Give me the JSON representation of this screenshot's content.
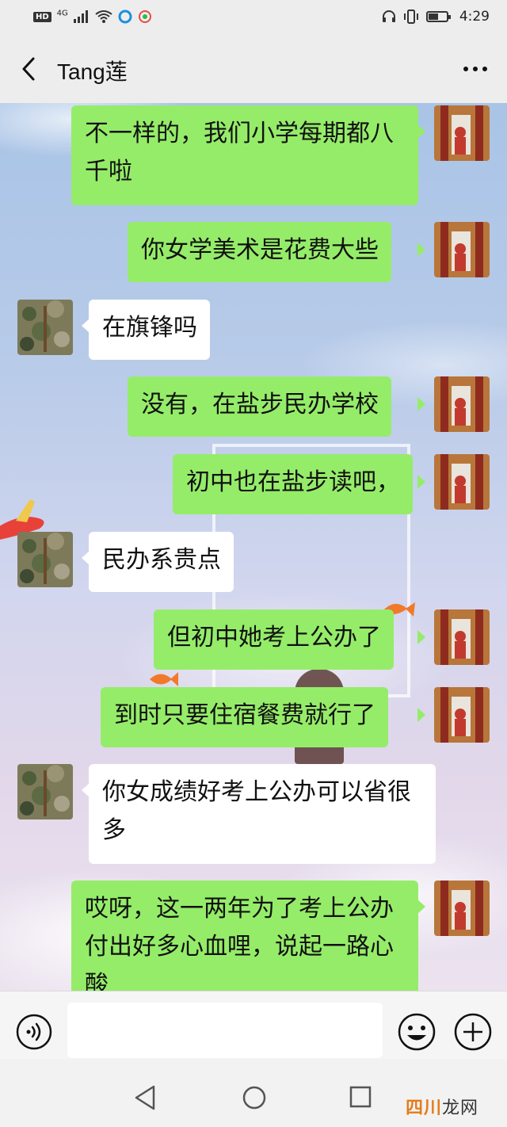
{
  "status_bar": {
    "network_badge": "HD",
    "network_type": "4G",
    "time": "4:29"
  },
  "header": {
    "title": "Tang莲"
  },
  "messages": [
    {
      "side": "right",
      "text": "不一样的，我们小学每期都八千啦"
    },
    {
      "side": "right",
      "text": "你女学美术是花费大些"
    },
    {
      "side": "left",
      "text": "在旗锋吗"
    },
    {
      "side": "right",
      "text": "没有，在盐步民办学校"
    },
    {
      "side": "right",
      "text": "初中也在盐步读吧，"
    },
    {
      "side": "left",
      "text": "民办系贵点"
    },
    {
      "side": "right",
      "text": "但初中她考上公办了"
    },
    {
      "side": "right",
      "text": "到时只要住宿餐费就行了"
    },
    {
      "side": "left",
      "text": "你女成绩好考上公办可以省很多"
    },
    {
      "side": "right",
      "text": "哎呀，这一两年为了考上公办付出好多心血哩，说起一路心酸"
    }
  ],
  "input": {
    "value": ""
  },
  "colors": {
    "bubble_self": "#95ec69",
    "bubble_other": "#ffffff",
    "bar_bg": "#ededed"
  },
  "watermark": {
    "part1": "四川",
    "part2": "龙网"
  },
  "icons": [
    "back-icon",
    "more-icon",
    "voice-icon",
    "emoji-icon",
    "plus-icon",
    "nav-back-icon",
    "nav-home-icon",
    "nav-recent-icon"
  ]
}
